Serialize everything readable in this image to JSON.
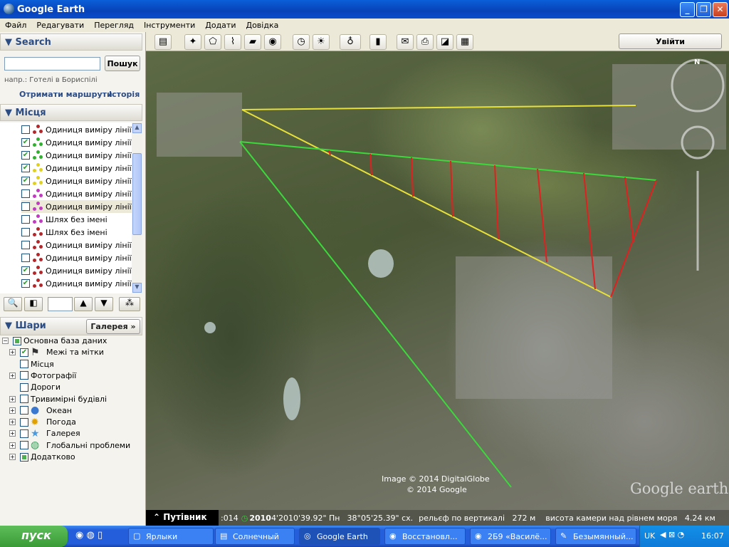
{
  "window": {
    "title": "Google Earth",
    "buttons": [
      "minimize",
      "restore",
      "close"
    ]
  },
  "menu": [
    "Файл",
    "Редагувати",
    "Перегляд",
    "Інструменти",
    "Додати",
    "Довідка"
  ],
  "search": {
    "header": "Search",
    "input_value": "",
    "button": "Пошук",
    "hint": "напр.: Готелі в Бориспілі",
    "directions_link": "Отримати маршрути",
    "history_link": "Історія"
  },
  "places": {
    "header": "Місця",
    "items": [
      {
        "label": "Одиниця виміру лінії",
        "checked": false,
        "color": "#b3262a"
      },
      {
        "label": "Одиниця виміру лінії",
        "checked": true,
        "color": "#2fb12f"
      },
      {
        "label": "Одиниця виміру лінії",
        "checked": true,
        "color": "#2fb12f"
      },
      {
        "label": "Одиниця виміру лінії",
        "checked": true,
        "color": "#e0d020"
      },
      {
        "label": "Одиниця виміру лінії",
        "checked": true,
        "color": "#e0d020"
      },
      {
        "label": "Одиниця виміру лінії",
        "checked": false,
        "color": "#c23ac2"
      },
      {
        "label": "Одиниця виміру лінії",
        "checked": false,
        "color": "#c23ac2",
        "selected": true
      },
      {
        "label": "Шлях без імені",
        "checked": false,
        "color": "#c23ac2"
      },
      {
        "label": "Шлях без імені",
        "checked": false,
        "color": "#b3262a"
      },
      {
        "label": "Одиниця виміру лінії",
        "checked": false,
        "color": "#b3262a"
      },
      {
        "label": "Одиниця виміру лінії",
        "checked": false,
        "color": "#b3262a"
      },
      {
        "label": "Одиниця виміру лінії",
        "checked": true,
        "color": "#b3262a"
      },
      {
        "label": "Одиниця виміру лінії",
        "checked": true,
        "color": "#b3262a"
      }
    ]
  },
  "layers": {
    "header": "Шари",
    "gallery_button": "Галерея »",
    "items": [
      {
        "label": "Основна база даних",
        "state": "partial",
        "expand": "minus",
        "indent": 0
      },
      {
        "label": "Межі та мітки",
        "state": "checked",
        "expand": "plus",
        "indent": 1,
        "icon": "flag-icon"
      },
      {
        "label": "Місця",
        "state": "unchecked",
        "expand": "",
        "indent": 1
      },
      {
        "label": "Фотографії",
        "state": "unchecked",
        "expand": "plus",
        "indent": 1
      },
      {
        "label": "Дороги",
        "state": "unchecked",
        "expand": "",
        "indent": 1
      },
      {
        "label": "Тривимірні будівлі",
        "state": "unchecked",
        "expand": "plus",
        "indent": 1
      },
      {
        "label": "Океан",
        "state": "unchecked",
        "expand": "plus",
        "indent": 1,
        "icon": "globe-icon"
      },
      {
        "label": "Погода",
        "state": "unchecked",
        "expand": "plus",
        "indent": 1,
        "icon": "sun-icon"
      },
      {
        "label": "Галерея",
        "state": "unchecked",
        "expand": "plus",
        "indent": 1,
        "icon": "star-icon"
      },
      {
        "label": "Глобальні проблеми",
        "state": "unchecked",
        "expand": "plus",
        "indent": 1,
        "icon": "earth-icon"
      },
      {
        "label": "Додатково",
        "state": "partial",
        "expand": "plus",
        "indent": 1
      }
    ]
  },
  "toolbar": {
    "signin": "Увійти"
  },
  "map": {
    "credit1": "Image © 2014 DigitalGlobe",
    "credit2": "© 2014 Google",
    "logo": "Google earth",
    "compass_north": "N"
  },
  "statusbar": {
    "guide": "Путівник",
    "date": ":014",
    "year": "2010",
    "coords_lat": "4'2010'39.92\" Пн",
    "coords_lon": "38°05'25.39\" сх.",
    "elevation": "рельєф по вертикалі   272 м",
    "eye_alt": "висота камери над рівнем моря   4.24 км"
  },
  "taskbar": {
    "start": "пуск",
    "tasks": [
      {
        "label": "Ярлыки",
        "active": false
      },
      {
        "label": "Солнечный",
        "active": false
      },
      {
        "label": "Google Earth",
        "active": true
      },
      {
        "label": "Восстановл...",
        "active": false
      },
      {
        "label": "2Б9 «Василё...",
        "active": false
      },
      {
        "label": "Безымянный...",
        "active": false
      }
    ],
    "lang": "UK",
    "clock": "16:07"
  }
}
